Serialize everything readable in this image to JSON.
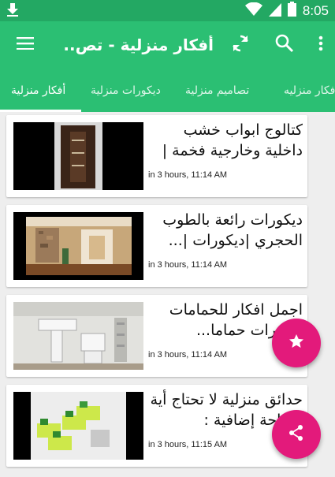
{
  "status": {
    "time": "8:05",
    "icons": [
      "download-icon",
      "wifi-icon",
      "signal-icon",
      "battery-icon"
    ]
  },
  "toolbar": {
    "title": "أفكار منزلية - تص..",
    "icons": [
      "menu-icon",
      "refresh-icon",
      "search-icon",
      "more-vert-icon"
    ]
  },
  "tabs": [
    {
      "label": "أفكار منزلية",
      "active": true
    },
    {
      "label": "ديكورات منزلية",
      "active": false
    },
    {
      "label": "تصاميم منزلية",
      "active": false
    },
    {
      "label": "افكار منزليه",
      "active": false
    }
  ],
  "articles": [
    {
      "title": "كتالوج ابواب خشب داخلية وخارجية فخمة | تصاميم...",
      "time": "in 3 hours, 11:14 AM"
    },
    {
      "title": "ديكورات رائعة بالطوب الحجري |ديكورات |...",
      "time": "in 3 hours, 11:14 AM"
    },
    {
      "title": "اجمل افكار للحمامات ديكورات حماما...",
      "time": "in 3 hours, 11:14 AM"
    },
    {
      "title": "حدائق منزلية لا تحتاج أية مساحة إضافية : حدائق...",
      "time": "in 3 hours, 11:15 AM"
    }
  ],
  "colors": {
    "primary": "#2bbf73",
    "status_bar": "#23a863",
    "accent": "#e31a7b"
  },
  "fabs": [
    "star-icon",
    "share-icon"
  ]
}
